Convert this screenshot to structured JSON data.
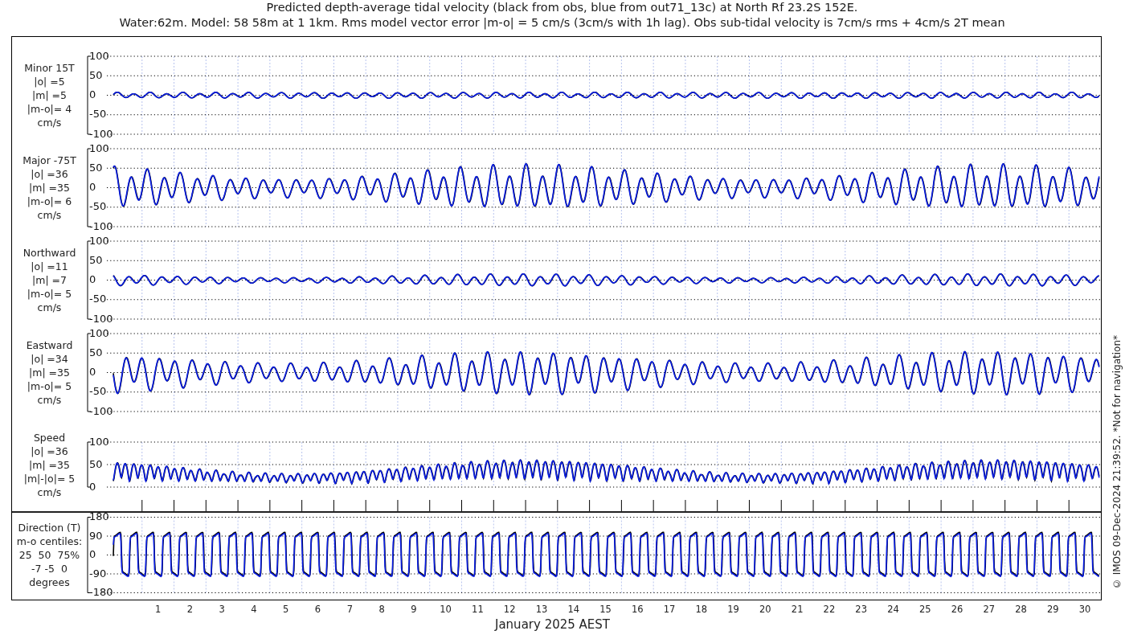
{
  "title": {
    "line_1": "Predicted depth-average tidal velocity (black from obs, blue from out71_13c) at North Rf 23.2S 152E.",
    "line_2": "Water:62m. Model: 58 58m at 1 1km. Rms model vector error |m-o| = 5 cm/s (3cm/s with 1h lag). Obs sub-tidal velocity is 7cm/s rms + 4cm/s 2T mean"
  },
  "panels": [
    {
      "kind": "velocity",
      "label_lines": [
        "Minor 15T",
        "|o| =5",
        "|m| =5",
        "|m-o|= 4",
        "cm/s"
      ],
      "y_ticks": [
        "100",
        "50",
        "0",
        "-50",
        "-100"
      ]
    },
    {
      "kind": "velocity",
      "label_lines": [
        "Major -75T",
        "|o| =36",
        "|m| =35",
        "|m-o|= 6",
        "cm/s"
      ],
      "y_ticks": [
        "100",
        "50",
        "0",
        "-50",
        "-100"
      ]
    },
    {
      "kind": "velocity",
      "label_lines": [
        "Northward",
        "|o| =11",
        "|m| =7",
        "|m-o|= 5",
        "cm/s"
      ],
      "y_ticks": [
        "100",
        "50",
        "0",
        "-50",
        "-100"
      ]
    },
    {
      "kind": "velocity",
      "label_lines": [
        "Eastward",
        "|o| =34",
        "|m| =35",
        "|m-o|= 5",
        "cm/s"
      ],
      "y_ticks": [
        "100",
        "50",
        "0",
        "-50",
        "-100"
      ]
    },
    {
      "kind": "speed",
      "label_lines": [
        "Speed",
        "|o| =36",
        "|m| =35",
        "|m|-|o|= 5",
        "cm/s"
      ],
      "y_ticks": [
        "100",
        "50",
        "0"
      ]
    },
    {
      "kind": "direction",
      "label_lines": [
        "Direction (T)",
        "m-o centiles:",
        "25  50  75%",
        "-7 -5  0",
        "degrees"
      ],
      "y_ticks": [
        "180",
        "90",
        "0",
        "-90",
        "-180"
      ]
    }
  ],
  "x_axis": {
    "day_labels": [
      "1",
      "2",
      "3",
      "4",
      "5",
      "6",
      "7",
      "8",
      "9",
      "10",
      "11",
      "12",
      "13",
      "14",
      "15",
      "16",
      "17",
      "18",
      "19",
      "20",
      "21",
      "22",
      "23",
      "24",
      "25",
      "26",
      "27",
      "28",
      "29",
      "30"
    ],
    "label": "January 2025 AEST"
  },
  "credit": "© IMOS 09-Dec-2024 21:39:52. *Not for navigation*"
}
